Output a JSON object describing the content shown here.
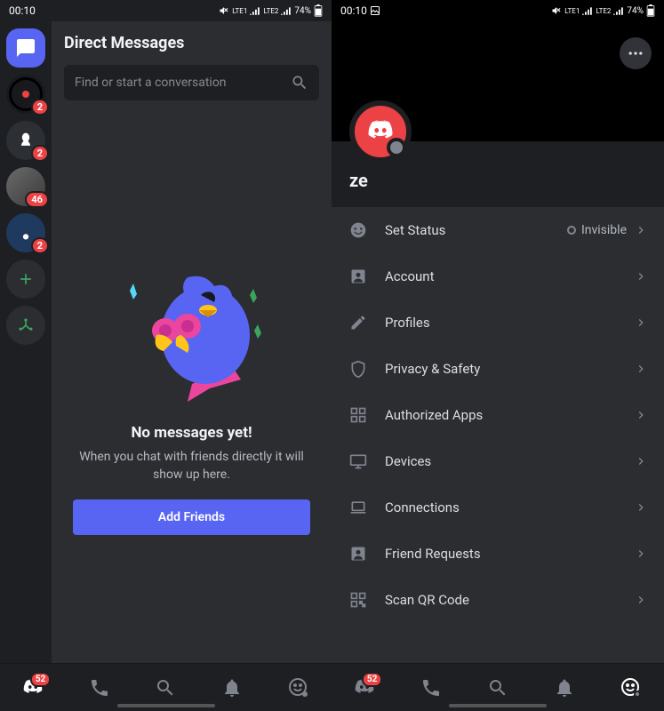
{
  "status": {
    "time": "00:10",
    "battery": "74%",
    "network1": "LTE1",
    "network2": "LTE2"
  },
  "left": {
    "title": "Direct Messages",
    "search_placeholder": "Find or start a conversation",
    "servers": [
      {
        "type": "dm",
        "badge": null
      },
      {
        "type": "server",
        "badge": "2",
        "color": "#18191c"
      },
      {
        "type": "server",
        "badge": "2",
        "color": "#2c2f33"
      },
      {
        "type": "server",
        "badge": "46",
        "color": "#4a4d52"
      },
      {
        "type": "server",
        "badge": "2",
        "color": "#1e3a5f"
      }
    ],
    "empty": {
      "title": "No messages yet!",
      "subtitle": "When you chat with friends directly it will show up here.",
      "button": "Add Friends"
    },
    "nav_badge": "52"
  },
  "right": {
    "username": "ze",
    "status_value": "Invisible",
    "settings": [
      {
        "icon": "status",
        "label": "Set Status",
        "value": "Invisible"
      },
      {
        "icon": "account",
        "label": "Account"
      },
      {
        "icon": "profiles",
        "label": "Profiles"
      },
      {
        "icon": "privacy",
        "label": "Privacy & Safety"
      },
      {
        "icon": "apps",
        "label": "Authorized Apps"
      },
      {
        "icon": "devices",
        "label": "Devices"
      },
      {
        "icon": "connections",
        "label": "Connections"
      },
      {
        "icon": "friends",
        "label": "Friend Requests"
      },
      {
        "icon": "qr",
        "label": "Scan QR Code"
      }
    ],
    "nav_badge": "52"
  }
}
